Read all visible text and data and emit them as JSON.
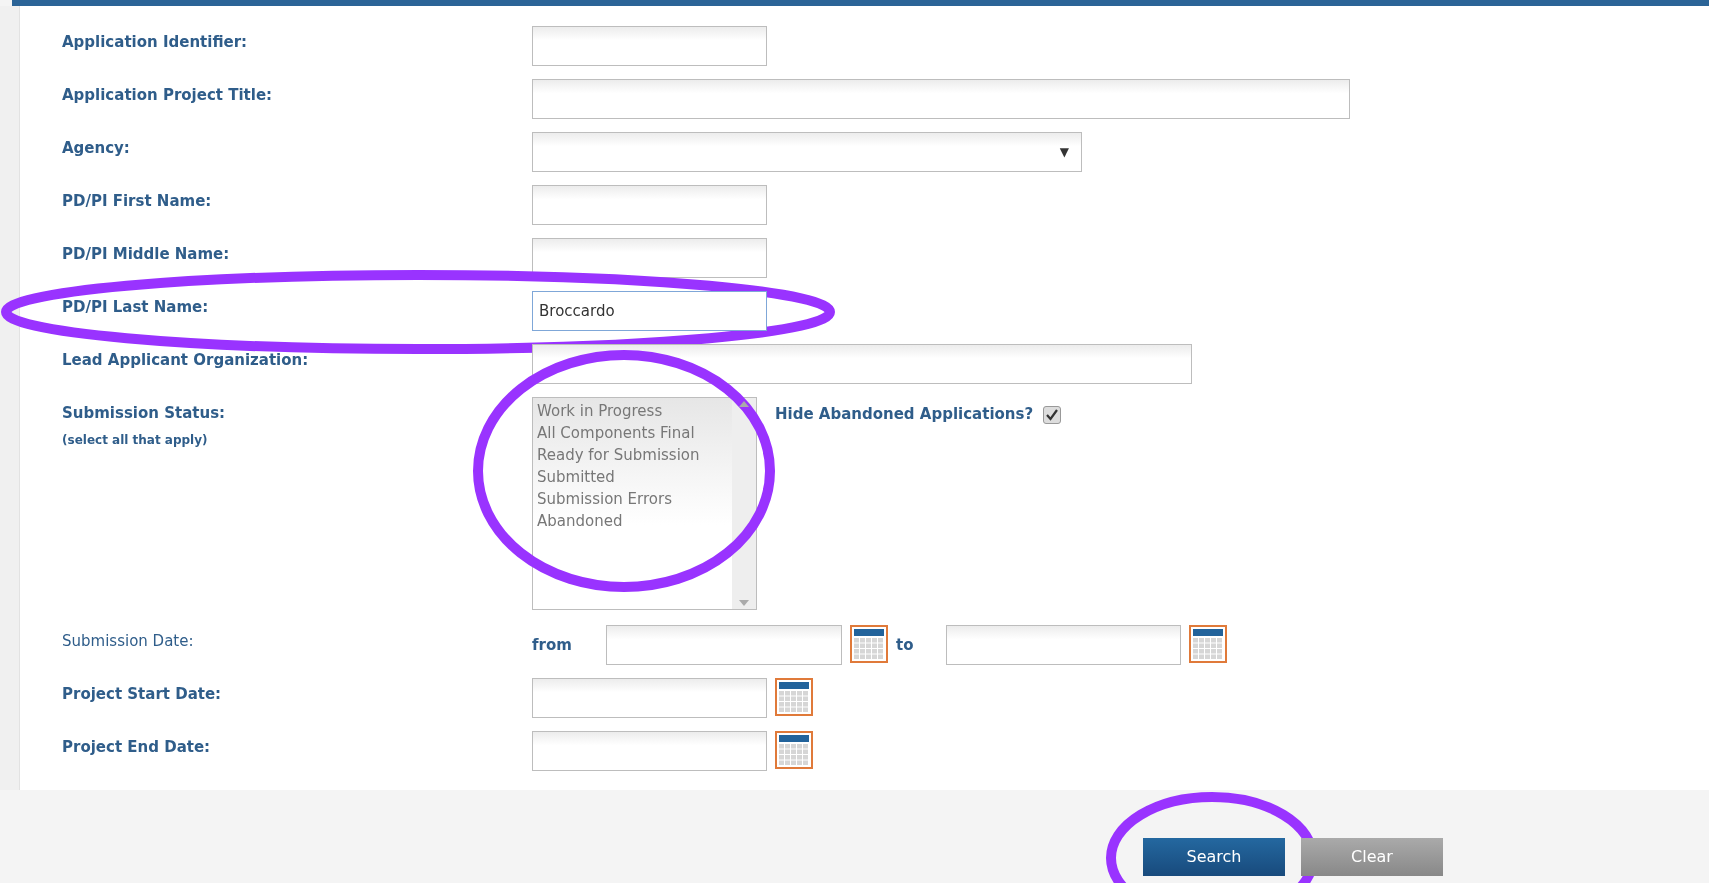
{
  "fields": [
    {
      "kind": "short_text",
      "label": "Application Identifier:",
      "highlighted": false
    },
    {
      "kind": "wide_text",
      "label": "Application Project Title:",
      "highlighted": false
    },
    {
      "kind": "select",
      "label": "Agency:",
      "arrow": "▼",
      "highlighted": false
    },
    {
      "kind": "short_text",
      "label": "PD/PI First Name:",
      "highlighted": false
    },
    {
      "kind": "short_text",
      "label": "PD/PI Middle Name:",
      "highlighted": false
    },
    {
      "kind": "short_text",
      "label": "PD/PI Last Name:",
      "value": "Broccardo",
      "focused": true,
      "highlighted": true
    },
    {
      "kind": "medium_text",
      "label": "Lead Applicant Organization:",
      "highlighted": false
    },
    {
      "kind": "listbox",
      "label": "Submission Status:",
      "hint": "(select all that apply)",
      "options": [
        "Work in Progress",
        "All Components Final",
        "Ready for Submission",
        "Submitted",
        "Submission Errors",
        "Abandoned"
      ],
      "highlighted": true,
      "checkbox": {
        "label": "Hide Abandoned Applications?",
        "checked": true
      }
    },
    {
      "kind": "daterange",
      "label": "Submission Date:",
      "from_label": "from",
      "to_label": "to",
      "highlighted": false
    },
    {
      "kind": "date",
      "label": "Project Start Date:",
      "highlighted": false
    },
    {
      "kind": "date",
      "label": "Project End Date:",
      "highlighted": false
    }
  ],
  "buttons": [
    {
      "kind": "primary",
      "label": "Search",
      "highlighted": true
    },
    {
      "kind": "secondary",
      "label": "Clear",
      "highlighted": false
    }
  ]
}
